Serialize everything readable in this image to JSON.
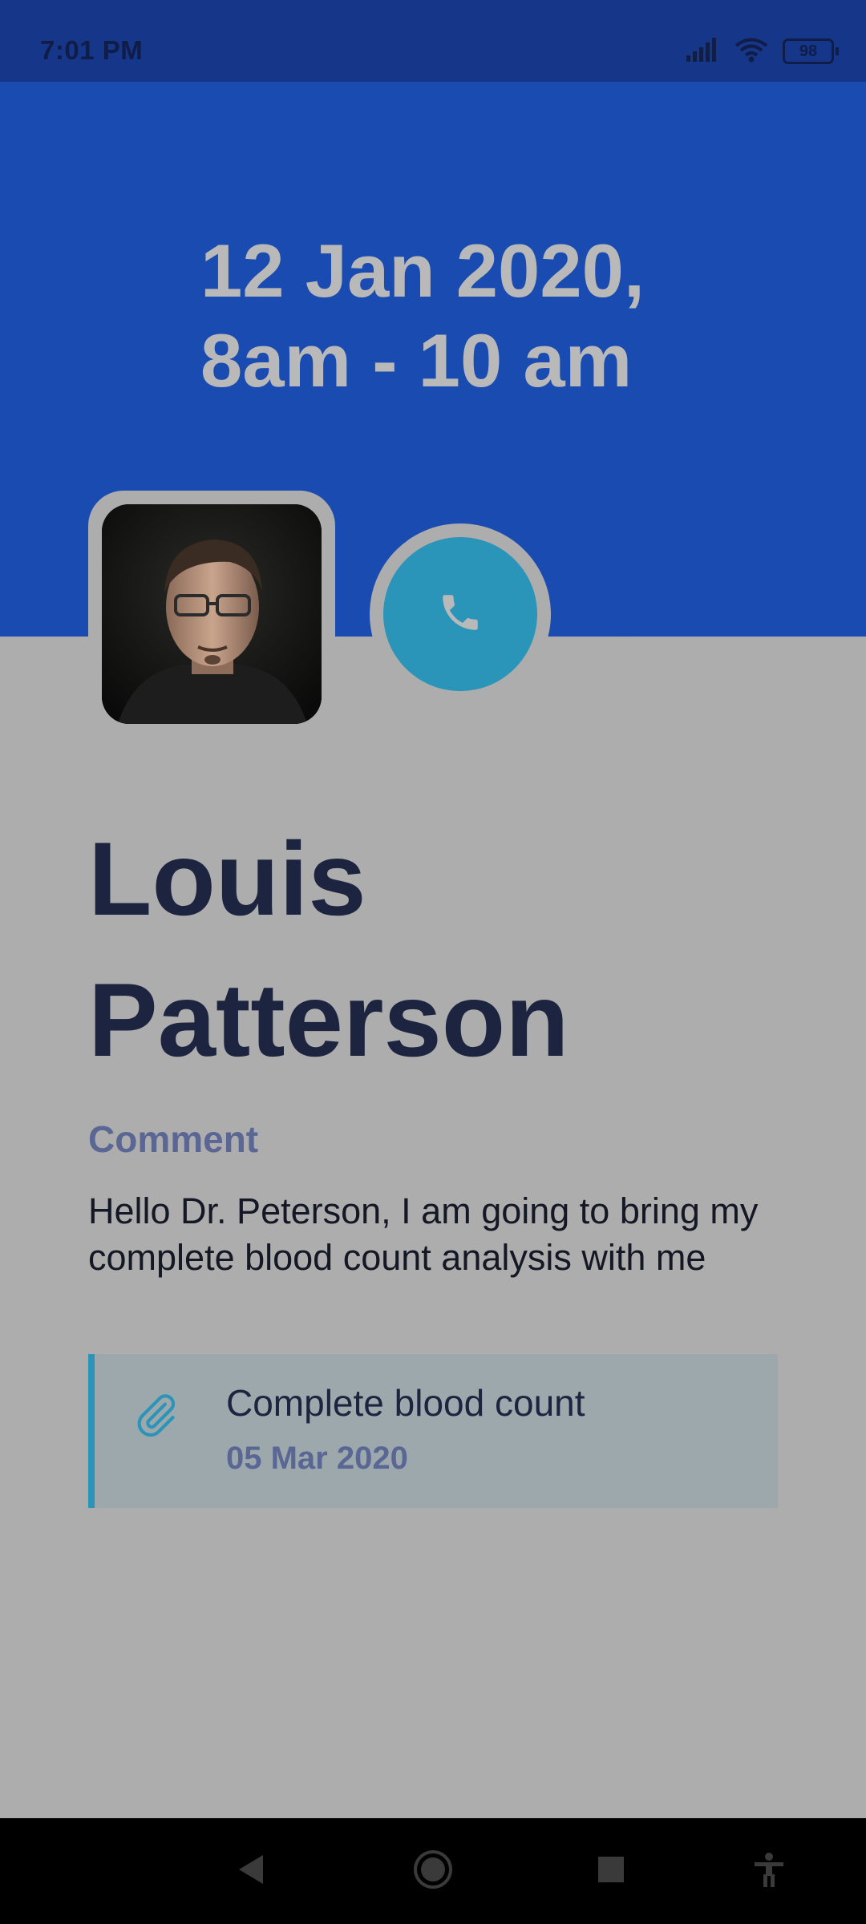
{
  "status_bar": {
    "time": "7:01 PM",
    "battery": "98",
    "icons": [
      "signal-icon",
      "wifi-icon",
      "battery-icon"
    ]
  },
  "appointment": {
    "date_line1": "12 Jan 2020,",
    "date_line2": "8am - 10 am"
  },
  "patient": {
    "first_name": "Louis",
    "last_name": "Patterson",
    "avatar_icon": "patient-photo"
  },
  "comment": {
    "label": "Comment",
    "text": "Hello Dr. Peterson, I am going to bring my complete blood count analysis with me"
  },
  "attachment": {
    "name": "Complete blood count",
    "date": "05 Mar 2020",
    "icon": "paperclip-icon"
  },
  "colors": {
    "header_blue": "#194bb0",
    "status_bar": "#16368a",
    "accent_teal": "#2a94b9",
    "name_text": "#1c2440",
    "muted_label": "#5a6693",
    "background": "#adadad"
  },
  "nav_bar": {
    "buttons": [
      "back-icon",
      "home-icon",
      "recents-icon",
      "accessibility-icon"
    ]
  }
}
